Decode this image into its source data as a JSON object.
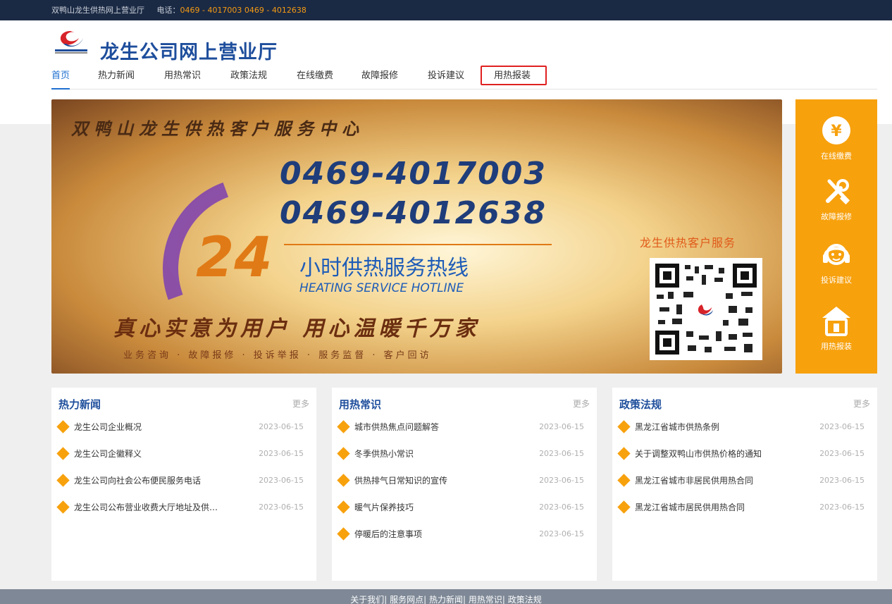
{
  "topbar": {
    "site_name": "双鸭山龙生供热网上营业厅",
    "phone_label": "电话：",
    "phone_numbers": "0469 - 4017003 0469 - 4012638"
  },
  "header": {
    "title": "龙生公司网上营业厅"
  },
  "nav": {
    "items": [
      "首页",
      "热力新闻",
      "用热常识",
      "政策法规",
      "在线缴费",
      "故障报修",
      "投诉建议",
      "用热报装"
    ]
  },
  "banner": {
    "heading": "双鸭山龙生供热客户服务中心",
    "phone1": "0469-4017003",
    "phone2": "0469-4012638",
    "big_number": "24",
    "hotline_cn": "小时供热服务热线",
    "hotline_en": "HEATING SERVICE HOTLINE",
    "slogan": "真心实意为用户  用心温暖千万家",
    "services": "业务咨询 · 故障报修 · 投诉举报 · 服务监督 · 客户回访",
    "service_label": "龙生供热客户服务"
  },
  "sidebar": {
    "items": [
      {
        "label": "在线缴费",
        "icon": "yen-icon"
      },
      {
        "label": "故障报修",
        "icon": "tools-icon"
      },
      {
        "label": "投诉建议",
        "icon": "headset-icon"
      },
      {
        "label": "用热报装",
        "icon": "house-icon"
      }
    ]
  },
  "cards": [
    {
      "title": "热力新闻",
      "more": "更多",
      "items": [
        {
          "text": "龙生公司企业概况",
          "date": "2023-06-15"
        },
        {
          "text": "龙生公司企徽释义",
          "date": "2023-06-15"
        },
        {
          "text": "龙生公司向社会公布便民服务电话",
          "date": "2023-06-15"
        },
        {
          "text": "龙生公司公布营业收费大厅地址及供…",
          "date": "2023-06-15"
        }
      ]
    },
    {
      "title": "用热常识",
      "more": "更多",
      "items": [
        {
          "text": "城市供热焦点问题解答",
          "date": "2023-06-15"
        },
        {
          "text": "冬季供热小常识",
          "date": "2023-06-15"
        },
        {
          "text": "供热排气日常知识的宣传",
          "date": "2023-06-15"
        },
        {
          "text": "暖气片保养技巧",
          "date": "2023-06-15"
        },
        {
          "text": "停暖后的注意事项",
          "date": "2023-06-15"
        }
      ]
    },
    {
      "title": "政策法规",
      "more": "更多",
      "items": [
        {
          "text": "黑龙江省城市供热条例",
          "date": "2023-06-15"
        },
        {
          "text": "关于调整双鸭山市供热价格的通知",
          "date": "2023-06-15"
        },
        {
          "text": "黑龙江省城市非居民供用热合同",
          "date": "2023-06-15"
        },
        {
          "text": "黑龙江省城市居民供用热合同",
          "date": "2023-06-15"
        }
      ]
    }
  ],
  "footer": {
    "links": [
      "关于我们|",
      "服务网点|",
      "热力新闻|",
      "用热常识|",
      "政策法规"
    ]
  },
  "colors": {
    "brand_blue": "#1e4e9c",
    "accent_orange": "#f7a10d",
    "highlight_red": "#e02020",
    "topbar_bg": "#1b2a44"
  }
}
